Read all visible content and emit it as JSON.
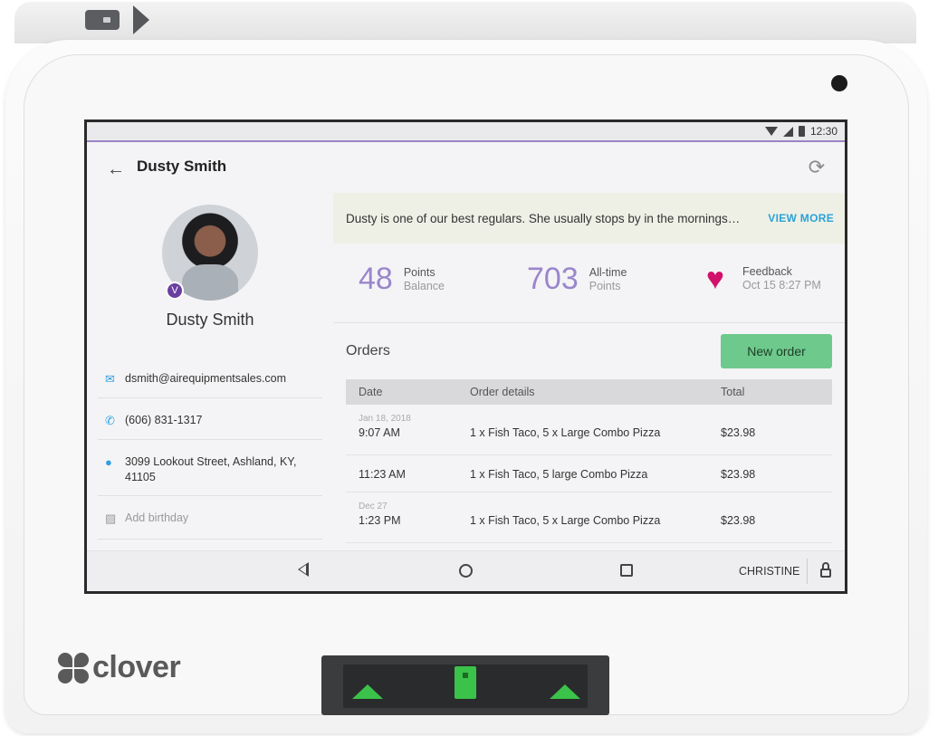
{
  "status_bar": {
    "time": "12:30"
  },
  "header": {
    "title": "Dusty Smith"
  },
  "customer": {
    "name": "Dusty Smith",
    "badge": "V",
    "email": "dsmith@airequipmentsales.com",
    "phone": "(606) 831-1317",
    "address_line1": "3099 Lookout Street, Ashland, KY,",
    "address_line2": "41105",
    "birthday_placeholder": "Add birthday"
  },
  "note": {
    "text": "Dusty is one of our best regulars. She usually stops by in the mornings…",
    "view_more": "VIEW MORE"
  },
  "stats": {
    "points_value": "48",
    "points_label": "Points",
    "points_sub": "Balance",
    "alltime_value": "703",
    "alltime_label": "All-time",
    "alltime_sub": "Points",
    "feedback_label": "Feedback",
    "feedback_sub": "Oct 15 8:27 PM"
  },
  "orders": {
    "title": "Orders",
    "new_order_label": "New order",
    "columns": [
      "Date",
      "Order details",
      "Total"
    ],
    "rows": [
      {
        "date": "Jan 18, 2018",
        "time": "9:07 AM",
        "details": "1 x Fish Taco, 5 x Large Combo Pizza",
        "total": "$23.98"
      },
      {
        "date": "",
        "time": "11:23 AM",
        "details": "1 x Fish Taco, 5 large Combo Pizza",
        "total": "$23.98"
      },
      {
        "date": "Dec 27",
        "time": "1:23 PM",
        "details": "1 x Fish Taco, 5 x Large Combo Pizza",
        "total": "$23.98"
      }
    ]
  },
  "nav_bar": {
    "user": "CHRISTINE"
  },
  "brand": {
    "logo_text": "clover",
    "accent_color": "#9a86cc",
    "button_color": "#6ec98c",
    "heart_color": "#d2116b"
  }
}
